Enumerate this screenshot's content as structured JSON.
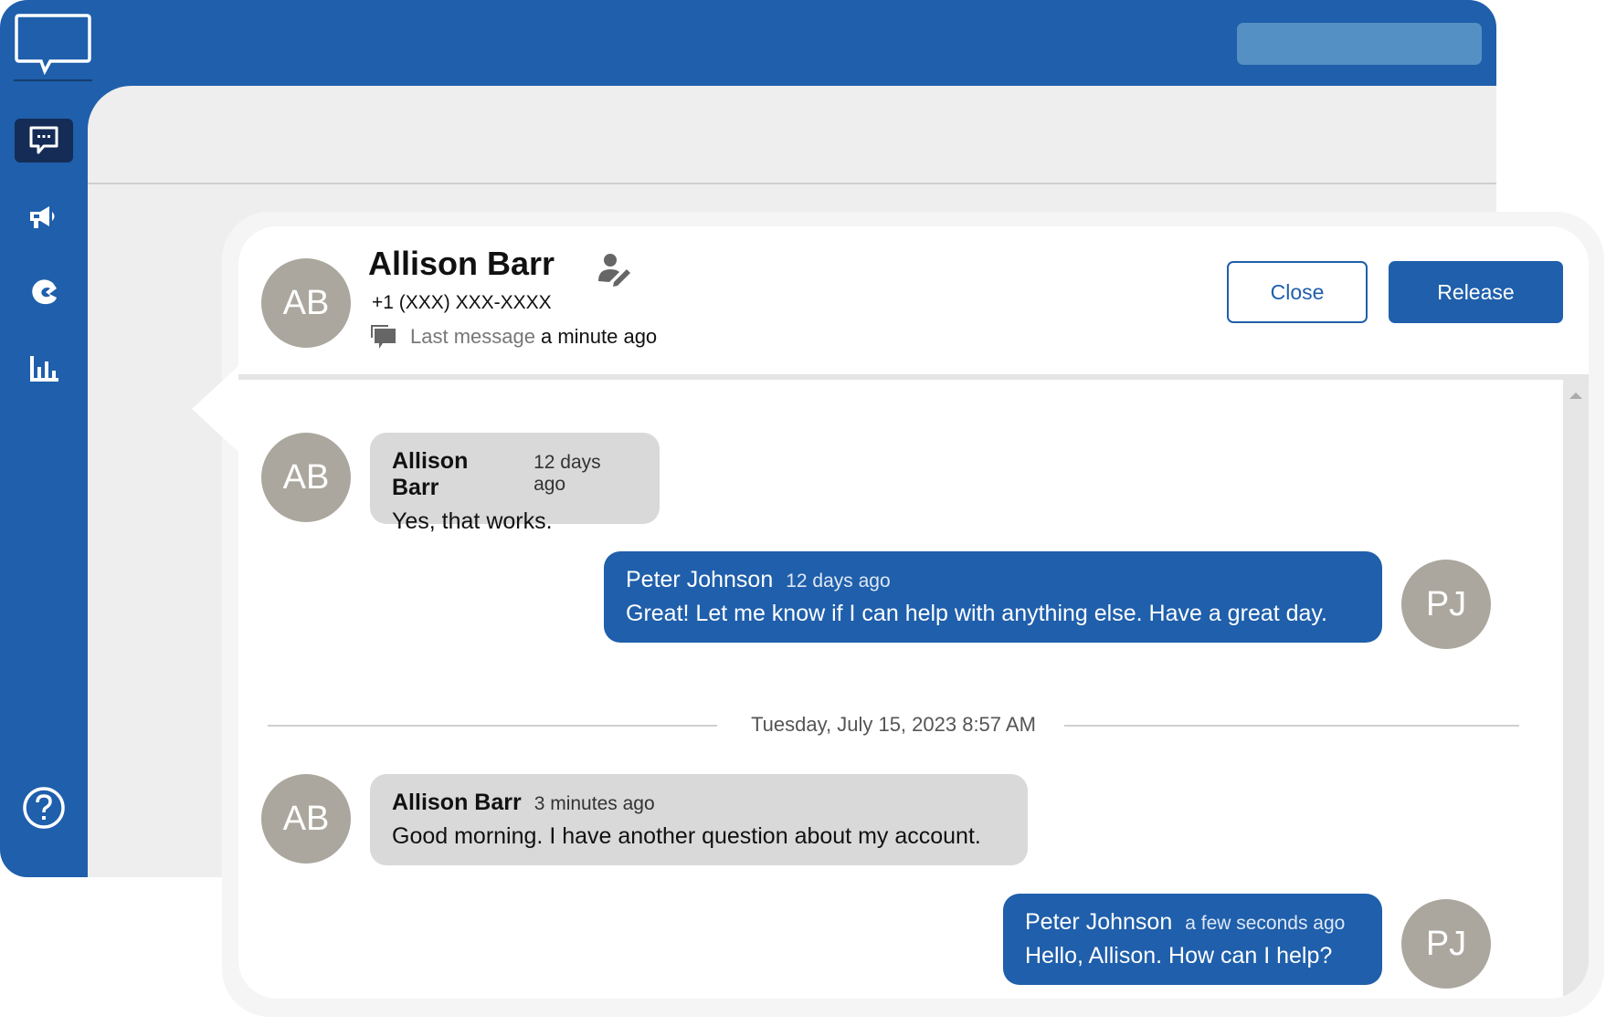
{
  "app": {
    "brand_icon": "chat-bubble-logo-icon",
    "nav": [
      {
        "name": "conversations",
        "icon": "chat-dots-icon",
        "active": true
      },
      {
        "name": "campaigns",
        "icon": "megaphone-icon",
        "active": false
      },
      {
        "name": "contacts",
        "icon": "brand-c-icon",
        "active": false
      },
      {
        "name": "reports",
        "icon": "bar-chart-icon",
        "active": false
      }
    ],
    "help_icon": "help-circle-icon",
    "colors": {
      "primary": "#1f5fab",
      "nav_active": "#142c56",
      "incoming_bubble": "#d9d9d9",
      "avatar": "#aba79e"
    }
  },
  "conversation": {
    "contact": {
      "initials": "AB",
      "name": "Allison Barr",
      "phone": "+1 (XXX) XXX-XXXX",
      "last_message_label": "Last message",
      "last_message_value": "a minute ago"
    },
    "actions": {
      "close_label": "Close",
      "release_label": "Release"
    },
    "messages": [
      {
        "direction": "in",
        "initials": "AB",
        "sender": "Allison Barr",
        "time": "12 days ago",
        "text": "Yes, that works."
      },
      {
        "direction": "out",
        "initials": "PJ",
        "sender": "Peter Johnson",
        "time": "12 days ago",
        "text": "Great! Let me know if I can help with anything else. Have a great day."
      },
      {
        "direction": "in",
        "initials": "AB",
        "sender": "Allison Barr",
        "time": "3 minutes ago",
        "text": "Good morning. I have another question about my account."
      },
      {
        "direction": "out",
        "initials": "PJ",
        "sender": "Peter Johnson",
        "time": "a few seconds ago",
        "text": "Hello, Allison. How can I help?"
      }
    ],
    "date_separator": "Tuesday, July 15, 2023 8:57 AM"
  }
}
